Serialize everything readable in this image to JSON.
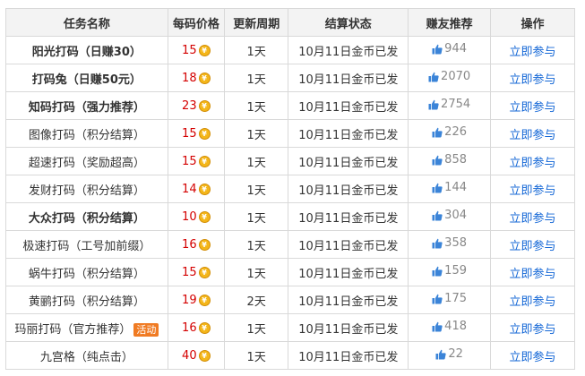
{
  "headers": {
    "name": "任务名称",
    "price": "每码价格",
    "cycle": "更新周期",
    "status": "结算状态",
    "recommend": "赚友推荐",
    "operation": "操作"
  },
  "coin_symbol": "¥",
  "rows": [
    {
      "name": "阳光打码（日赚30）",
      "style": "bold",
      "price": "15",
      "cycle": "1天",
      "status": "10月11日金币已发",
      "recommend": "944",
      "action": "立即参与",
      "badge": ""
    },
    {
      "name": "打码兔（日赚50元）",
      "style": "bold",
      "price": "18",
      "cycle": "1天",
      "status": "10月11日金币已发",
      "recommend": "2070",
      "action": "立即参与",
      "badge": ""
    },
    {
      "name": "知码打码（强力推荐）",
      "style": "bold",
      "price": "23",
      "cycle": "1天",
      "status": "10月11日金币已发",
      "recommend": "2754",
      "action": "立即参与",
      "badge": ""
    },
    {
      "name": "图像打码（积分结算）",
      "style": "red",
      "price": "15",
      "cycle": "1天",
      "status": "10月11日金币已发",
      "recommend": "226",
      "action": "立即参与",
      "badge": ""
    },
    {
      "name": "超速打码（奖励超高）",
      "style": "red",
      "price": "15",
      "cycle": "1天",
      "status": "10月11日金币已发",
      "recommend": "858",
      "action": "立即参与",
      "badge": ""
    },
    {
      "name": "发财打码（积分结算）",
      "style": "normal",
      "price": "14",
      "cycle": "1天",
      "status": "10月11日金币已发",
      "recommend": "144",
      "action": "立即参与",
      "badge": ""
    },
    {
      "name": "大众打码（积分结算）",
      "style": "bold",
      "price": "10",
      "cycle": "1天",
      "status": "10月11日金币已发",
      "recommend": "304",
      "action": "立即参与",
      "badge": ""
    },
    {
      "name": "极速打码（工号加前缀）",
      "style": "normal",
      "price": "16",
      "cycle": "1天",
      "status": "10月11日金币已发",
      "recommend": "358",
      "action": "立即参与",
      "badge": ""
    },
    {
      "name": "蜗牛打码（积分结算）",
      "style": "normal",
      "price": "15",
      "cycle": "1天",
      "status": "10月11日金币已发",
      "recommend": "159",
      "action": "立即参与",
      "badge": ""
    },
    {
      "name": "黄鹂打码（积分结算）",
      "style": "normal",
      "price": "19",
      "cycle": "2天",
      "status": "10月11日金币已发",
      "recommend": "175",
      "action": "立即参与",
      "badge": ""
    },
    {
      "name": "玛丽打码（官方推荐）",
      "style": "red",
      "price": "16",
      "cycle": "1天",
      "status": "10月11日金币已发",
      "recommend": "418",
      "action": "立即参与",
      "badge": "活动"
    },
    {
      "name": "九宫格（纯点击）",
      "style": "normal",
      "price": "40",
      "cycle": "1天",
      "status": "10月11日金币已发",
      "recommend": "22",
      "action": "立即参与",
      "badge": ""
    }
  ],
  "colors": {
    "name_red": "#c00000",
    "price_red": "#d40000",
    "link_blue": "#1467d6",
    "badge_orange": "#f07b23",
    "header_bg": "#f3f3f3",
    "coin_gold": "#f4b619",
    "thumb_blue": "#3b84d8"
  },
  "icons": {
    "coin": "coin-icon",
    "recommend": "thumbs-up-icon"
  }
}
